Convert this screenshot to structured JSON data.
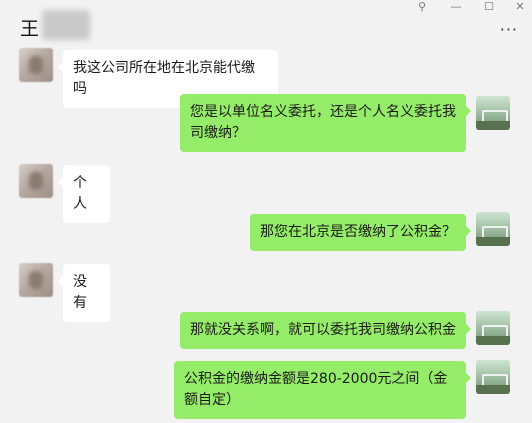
{
  "chat": {
    "title": "王",
    "window_controls": {
      "pin": "⚲",
      "minimize": "—",
      "maximize": "☐",
      "close": "✕"
    },
    "more_label": "···"
  },
  "messages": [
    {
      "side": "left",
      "text": "我这公司所在地在北京能代缴吗"
    },
    {
      "side": "right",
      "text": "您是以单位名义委托，还是个人名义委托我司缴纳？"
    },
    {
      "side": "left",
      "text": "个人"
    },
    {
      "side": "right",
      "text": "那您在北京是否缴纳了公积金？"
    },
    {
      "side": "left",
      "text": "没有"
    },
    {
      "side": "right",
      "text": "那就没关系啊，就可以委托我司缴纳公积金"
    },
    {
      "side": "right",
      "text": "公积金的缴纳金额是280-2000元之间（金额自定）"
    }
  ]
}
